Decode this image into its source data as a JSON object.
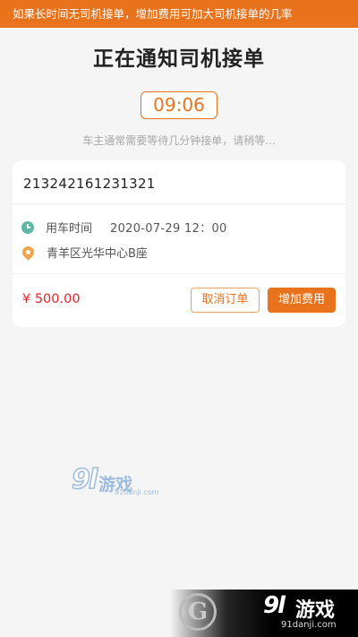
{
  "banner": {
    "text": "如果长时间无司机接单，增加费用可加大司机接单的几率"
  },
  "header": {
    "title": "正在通知司机接单"
  },
  "timer": {
    "value": "09:06"
  },
  "hint": {
    "text": "车主通常需要等待几分钟接单，请稍等..."
  },
  "order": {
    "number": "213242161231321",
    "time_label": "用车时间",
    "time_value": "2020-07-29  12：00",
    "address": "青羊区光华中心B座",
    "price": "¥ 500.00",
    "cancel_label": "取消订单",
    "add_fee_label": "增加费用"
  },
  "watermark": {
    "center_num": "9l",
    "center_text": "游戏",
    "center_url": "91danji.com",
    "corner_num": "9l",
    "corner_text": "游戏",
    "corner_url": "91danji.com"
  },
  "colors": {
    "accent": "#e8731c",
    "price": "#e5232a",
    "clock_icon": "#5db8a5",
    "pin_icon": "#f0a44a"
  }
}
